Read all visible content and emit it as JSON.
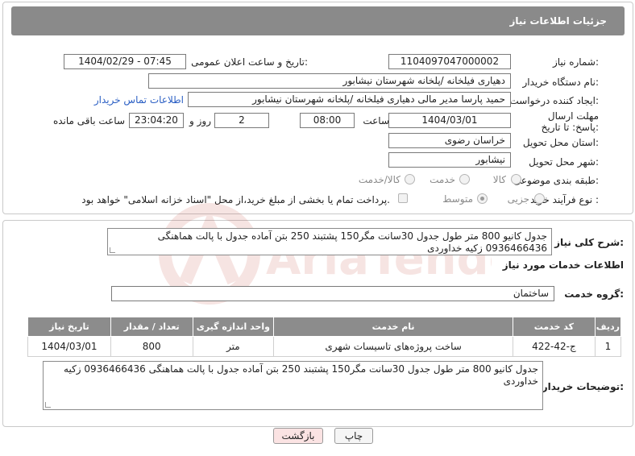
{
  "header": {
    "title": "جزئیات اطلاعات نیاز"
  },
  "fields": {
    "need_number": {
      "label": "شماره نیاز:",
      "value": "1104097047000002"
    },
    "announce_datetime": {
      "label": "تاریخ و ساعت اعلان عمومی:",
      "value": "1404/02/29 - 07:45"
    },
    "buyer_org": {
      "label": "نام دستگاه خریدار:",
      "value": "دهیاری فیلخانه /پلخانه  شهرستان نیشابور"
    },
    "creator": {
      "label": "ایجاد کننده درخواست:",
      "value": "حمید پارسا مدیر مالی دهیاری فیلخانه /پلخانه  شهرستان نیشابور",
      "link": "اطلاعات تماس خریدار"
    },
    "deadline": {
      "label": "مهلت ارسال پاسخ: تا تاریخ:",
      "date": "1404/03/01",
      "time_label": "ساعت",
      "time": "08:00",
      "days": "2",
      "days_label": "روز و",
      "remaining": "23:04:20",
      "remaining_label": "ساعت باقی مانده"
    },
    "province": {
      "label": "استان محل تحویل:",
      "value": "خراسان رضوی"
    },
    "city": {
      "label": "شهر محل تحویل:",
      "value": "نیشابور"
    },
    "category": {
      "label": "طبقه بندی موضوعی:",
      "options": [
        "کالا",
        "خدمت",
        "کالا/خدمت"
      ]
    },
    "process_type": {
      "label": "نوع فرآیند خرید :",
      "options": [
        "جزیی",
        "متوسط"
      ],
      "payment_note": "پرداخت تمام یا بخشی از مبلغ خرید،از محل \"اسناد خزانه اسلامی\" خواهد بود."
    }
  },
  "summary": {
    "label": "شرح کلی نیاز:",
    "text": "جدول کانیو 800 متر طول جدول 30سانت مگر150 پشتبند 250 بتن آماده جدول با پالت هماهنگی 0936466436 زکیه خداوردی"
  },
  "services": {
    "section_title": "اطلاعات خدمات مورد نیاز",
    "group_label": "گروه خدمت:",
    "group_value": "ساختمان",
    "table": {
      "headers": [
        "ردیف",
        "کد خدمت",
        "نام خدمت",
        "واحد اندازه گیری",
        "تعداد / مقدار",
        "تاریخ نیاز"
      ],
      "rows": [
        [
          "1",
          "ج-42-422",
          "ساخت پروژه‌های تاسیسات شهری",
          "متر",
          "800",
          "1404/03/01"
        ]
      ]
    }
  },
  "buyer_notes": {
    "label": "توضیحات خریدار:",
    "text": "جدول کانیو 800 متر طول جدول 30سانت مگر150 پشتبند 250 بتن آماده جدول با پالت هماهنگی 0936466436 زکیه خداوردی"
  },
  "buttons": {
    "print": "چاپ",
    "back": "بازگشت"
  },
  "watermark": {
    "text": "AriaTender.neT"
  },
  "colors": {
    "header_bg": "#8a8a8a",
    "link": "#2b5fc4",
    "back_button_bg": "#fbe3e3",
    "watermark": "#c0392b"
  }
}
